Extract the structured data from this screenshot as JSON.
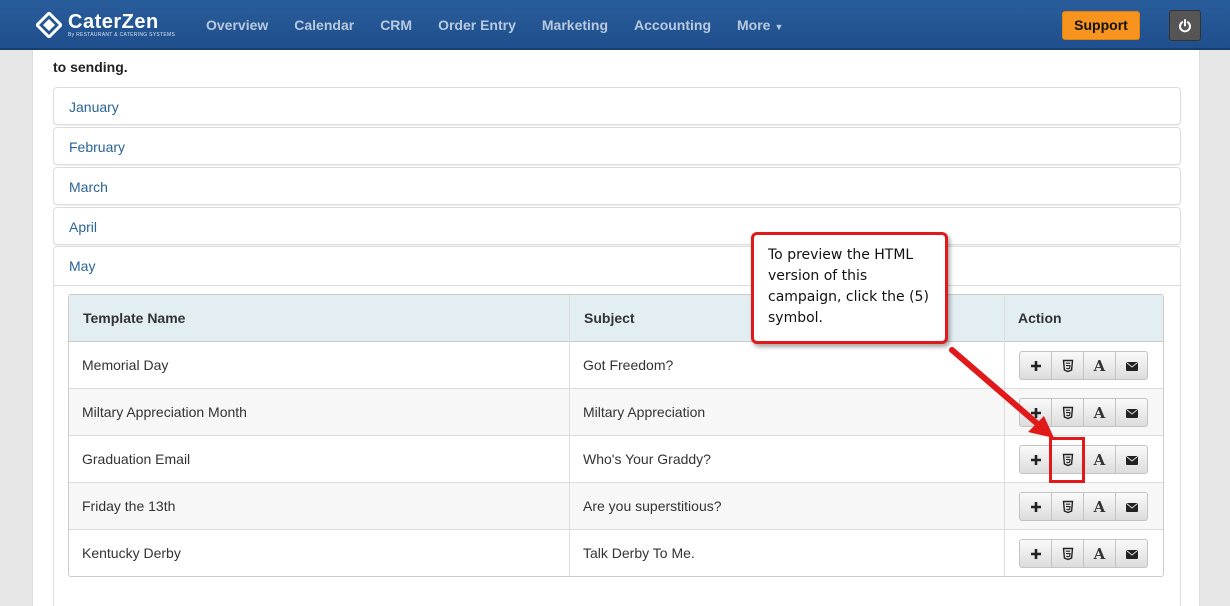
{
  "brand": {
    "name": "CaterZen",
    "tagline": "By RESTAURANT & CATERING SYSTEMS"
  },
  "nav": {
    "items": [
      "Overview",
      "Calendar",
      "CRM",
      "Order Entry",
      "Marketing",
      "Accounting",
      "More"
    ],
    "support_label": "Support"
  },
  "page": {
    "intro_text": "to sending.",
    "months": [
      "January",
      "February",
      "March",
      "April",
      "May"
    ]
  },
  "table": {
    "headers": [
      "Template Name",
      "Subject",
      "Action"
    ],
    "rows": [
      {
        "name": "Memorial Day",
        "subject": "Got Freedom?"
      },
      {
        "name": "Miltary Appreciation Month",
        "subject": "Miltary Appreciation"
      },
      {
        "name": "Graduation Email",
        "subject": "Who's Your Graddy?"
      },
      {
        "name": "Friday the 13th",
        "subject": "Are you superstitious?"
      },
      {
        "name": "Kentucky Derby",
        "subject": "Talk Derby To Me."
      }
    ],
    "action_icons": [
      "plus-icon",
      "html5-icon",
      "font-icon",
      "envelope-icon"
    ]
  },
  "callout": {
    "text": "To preview the HTML version of this campaign, click the (5) symbol."
  },
  "colors": {
    "navbar": "#1f4f8c",
    "support": "#f7941d",
    "annotation": "#e01a1a",
    "link": "#2a6496"
  }
}
